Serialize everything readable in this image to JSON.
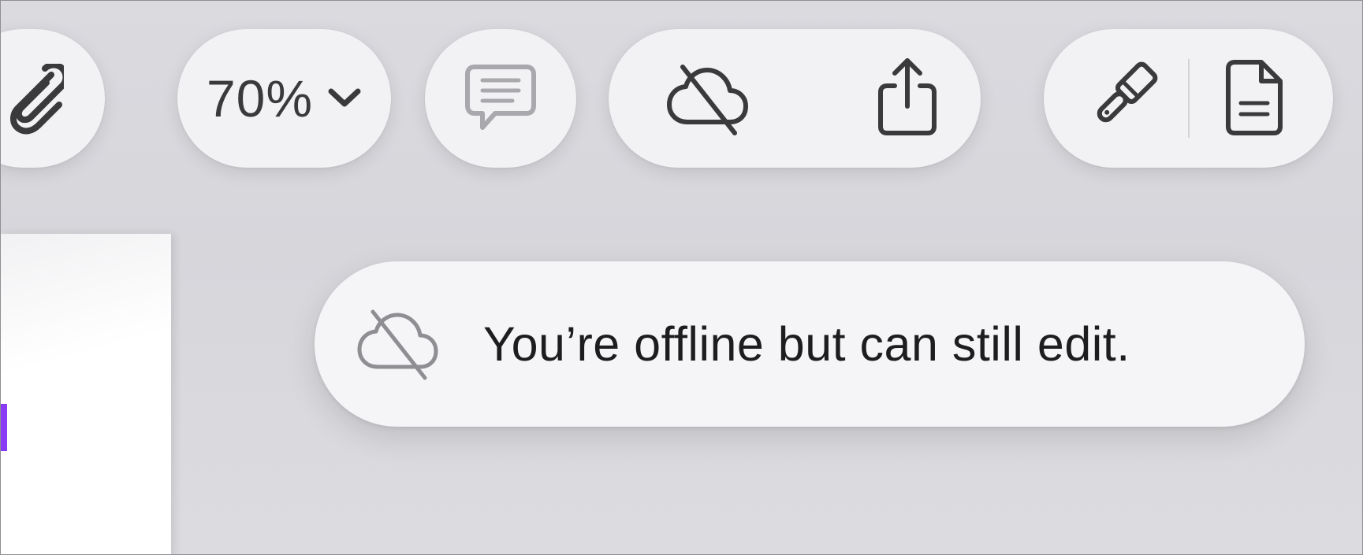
{
  "toolbar": {
    "zoom": {
      "value": "70%"
    },
    "icons": {
      "attachment": "paperclip-icon",
      "zoom_dropdown": "chevron-down-icon",
      "comment": "speech-bubble-icon",
      "offline_status": "cloud-slash-icon",
      "share": "share-icon",
      "format": "paintbrush-icon",
      "document": "document-icon"
    }
  },
  "notification": {
    "icon": "cloud-slash-icon",
    "message": "You’re offline but can still edit."
  },
  "colors": {
    "background": "#d8d8dd",
    "pill": "#f2f2f4",
    "icon": "#3a3a3c",
    "icon_disabled": "#a8a8ad",
    "text_cursor": "#8a3cf5"
  }
}
